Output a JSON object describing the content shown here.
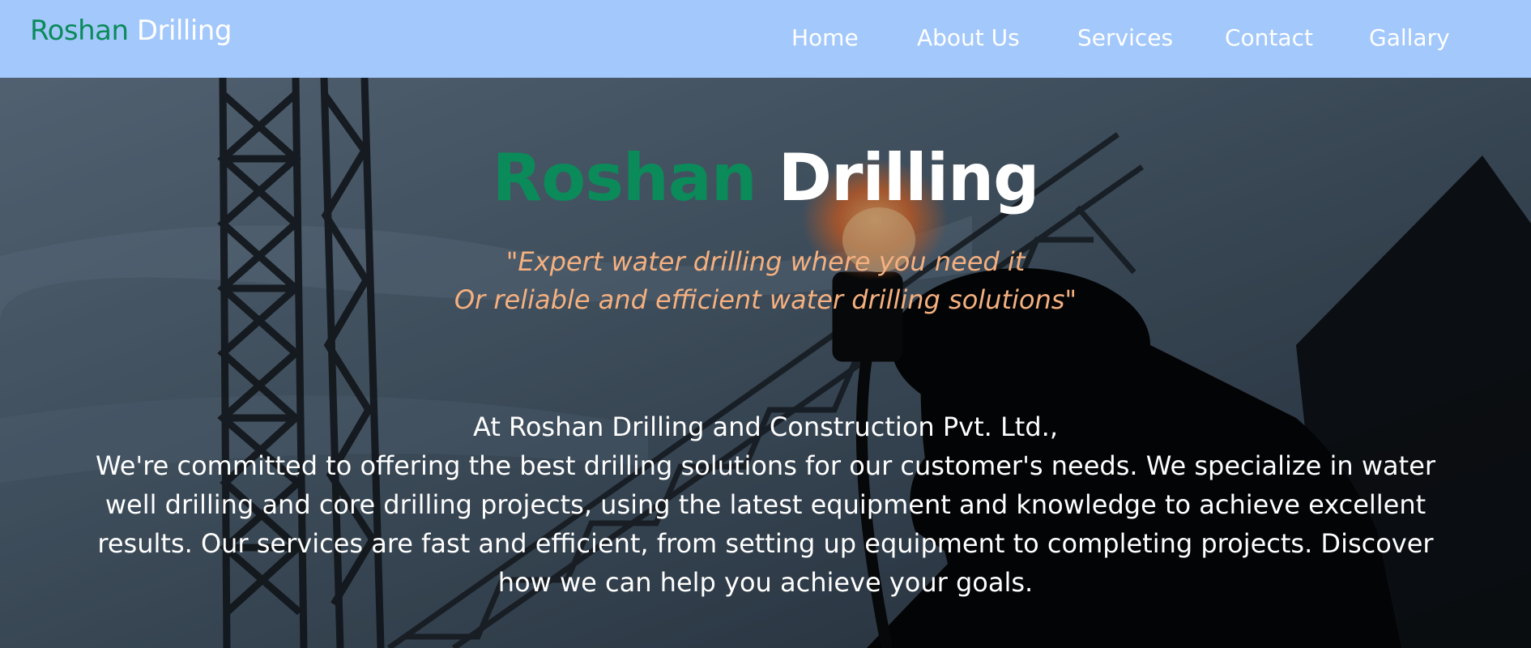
{
  "brand": {
    "first": "Roshan",
    "second": "Drilling"
  },
  "nav": {
    "items": [
      {
        "label": "Home"
      },
      {
        "label": "About Us"
      },
      {
        "label": "Services"
      },
      {
        "label": "Contact"
      },
      {
        "label": "Gallary"
      }
    ]
  },
  "hero": {
    "title_first": "Roshan",
    "title_second": "Drilling",
    "tagline_line1": "\"Expert water drilling where you need it",
    "tagline_line2": "Or reliable and efficient water drilling solutions\"",
    "intro_line1": "At Roshan Drilling and Construction Pvt. Ltd.,",
    "intro_body": "We're committed to offering the best drilling solutions for our customer's needs. We specialize in water well drilling and core drilling projects, using the latest equipment and knowledge to achieve excellent results. Our services are fast and efficient, from setting up equipment to completing projects. Discover how we can help you achieve your goals."
  },
  "colors": {
    "navbar_bg": "#a3c8fc",
    "brand_green": "#0b8a5a",
    "tagline_orange": "#f5b07f",
    "text_white": "#ffffff"
  }
}
